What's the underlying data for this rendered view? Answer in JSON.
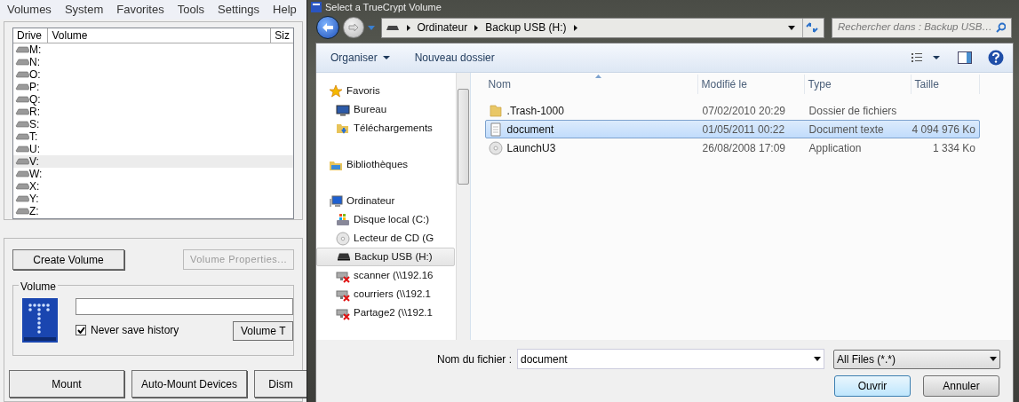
{
  "volume_window": {
    "menu": [
      "Volumes",
      "System",
      "Favorites",
      "Tools",
      "Settings",
      "Help"
    ],
    "drive_list": {
      "columns": [
        "Drive",
        "Volume",
        "Siz"
      ],
      "rows": [
        {
          "drive": "M:",
          "selected": false
        },
        {
          "drive": "N:",
          "selected": false
        },
        {
          "drive": "O:",
          "selected": false
        },
        {
          "drive": "P:",
          "selected": false
        },
        {
          "drive": "Q:",
          "selected": false
        },
        {
          "drive": "R:",
          "selected": false
        },
        {
          "drive": "S:",
          "selected": false
        },
        {
          "drive": "T:",
          "selected": false
        },
        {
          "drive": "U:",
          "selected": false
        },
        {
          "drive": "V:",
          "selected": true
        },
        {
          "drive": "W:",
          "selected": false
        },
        {
          "drive": "X:",
          "selected": false
        },
        {
          "drive": "Y:",
          "selected": false
        },
        {
          "drive": "Z:",
          "selected": false
        }
      ]
    },
    "create_volume_button": "Create Volume",
    "volume_properties_button": {
      "label": "Volume Properties...",
      "disabled": true
    },
    "volume_group": {
      "title": "Volume",
      "never_save_history": {
        "label": "Never save history",
        "checked": true
      },
      "volume_tools_button": "Volume T"
    },
    "buttons": [
      "Mount",
      "Auto-Mount Devices",
      "Dism"
    ]
  },
  "dialog": {
    "title": "Select a TrueCrypt Volume",
    "breadcrumbs": [
      "Ordinateur",
      "Backup USB (H:)"
    ],
    "search": {
      "placeholder": "Rechercher dans : Backup USB…"
    },
    "toolbar": {
      "organize": "Organiser",
      "new_folder": "Nouveau dossier"
    },
    "nav": [
      {
        "label": "Favoris",
        "kind": "star",
        "selected": false,
        "children": [
          {
            "label": "Bureau",
            "kind": "desktop",
            "selected": false
          },
          {
            "label": "Téléchargements",
            "kind": "downloads",
            "selected": false
          }
        ]
      },
      {
        "label": "Bibliothèques",
        "kind": "library",
        "selected": false
      },
      {
        "label": "Ordinateur",
        "kind": "computer",
        "selected": false,
        "children": [
          {
            "label": "Disque local (C:)",
            "kind": "disk",
            "selected": false
          },
          {
            "label": "Lecteur de CD (G",
            "kind": "cd",
            "selected": false
          },
          {
            "label": "Backup USB (H:)",
            "kind": "usb",
            "selected": true
          },
          {
            "label": "scanner (\\\\192.16",
            "kind": "network",
            "selected": false
          },
          {
            "label": "courriers (\\\\192.1",
            "kind": "network",
            "selected": false
          },
          {
            "label": "Partage2 (\\\\192.1",
            "kind": "network",
            "selected": false
          }
        ]
      }
    ],
    "file_columns": [
      "Nom",
      "Modifié le",
      "Type",
      "Taille"
    ],
    "files": [
      {
        "name": ".Trash-1000",
        "modified": "07/02/2010 20:29",
        "type": "Dossier de fichiers",
        "kind": "folder",
        "selected": false
      },
      {
        "name": "document",
        "modified": "01/05/2011 00:22",
        "type": "Document texte",
        "size": "4 094 976 Ko",
        "kind": "text",
        "selected": true
      },
      {
        "name": "LaunchU3",
        "modified": "26/08/2008 17:09",
        "type": "Application",
        "size": "1 334 Ko",
        "kind": "app",
        "selected": false
      }
    ],
    "file_name": {
      "label": "Nom du fichier :",
      "value": "document"
    },
    "file_type": "All Files (*.*)",
    "open_button": "Ouvrir",
    "cancel_button": "Annuler"
  }
}
